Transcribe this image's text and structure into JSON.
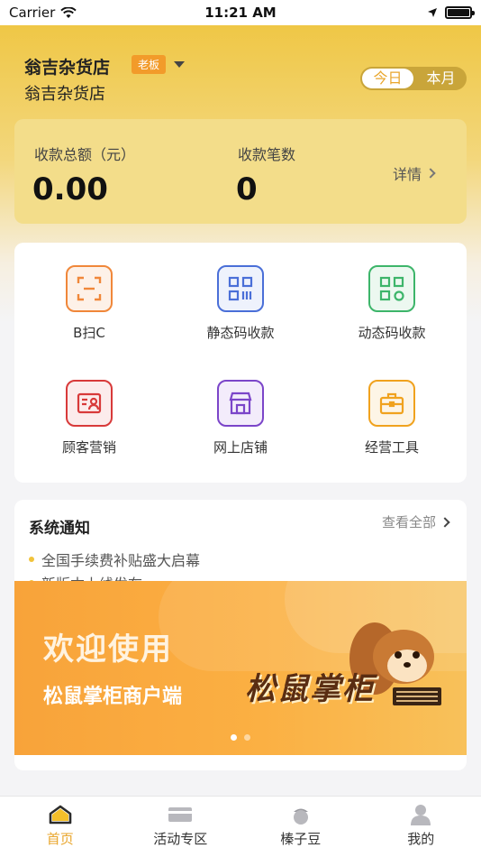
{
  "status_bar": {
    "carrier": "Carrier",
    "time": "11:21 AM"
  },
  "header": {
    "store_name": "翁吉杂货店",
    "role_badge": "老板",
    "store_subtitle": "翁吉杂货店",
    "period_toggle": {
      "today": "今日",
      "month": "本月",
      "selected": "today"
    }
  },
  "summary": {
    "amount_label": "收款总额（元）",
    "amount_value": "0.00",
    "count_label": "收款笔数",
    "count_value": "0",
    "details_label": "详情"
  },
  "features": [
    {
      "label": "B扫C",
      "icon": "scan-frame-icon",
      "color": "#f0873a",
      "bg": "#fdf1e8"
    },
    {
      "label": "静态码收款",
      "icon": "qr-code-icon",
      "color": "#4a6fd8",
      "bg": "#eef2fc"
    },
    {
      "label": "动态码收款",
      "icon": "dynamic-qr-icon",
      "color": "#3db56a",
      "bg": "#ecf8f0"
    },
    {
      "label": "顾客营销",
      "icon": "customer-card-icon",
      "color": "#d83a3a",
      "bg": "#fcecec"
    },
    {
      "label": "网上店铺",
      "icon": "storefront-icon",
      "color": "#7b45c9",
      "bg": "#f3ecfb"
    },
    {
      "label": "经营工具",
      "icon": "toolbox-icon",
      "color": "#f0a21e",
      "bg": "#fdf5e6"
    }
  ],
  "notices": {
    "title": "系统通知",
    "view_all": "查看全部",
    "items": [
      "全国手续费补贴盛大启幕",
      "新版本上线发布"
    ]
  },
  "banner": {
    "title": "欢迎使用",
    "subtitle": "松鼠掌柜商户端",
    "logo_text": "松鼠掌柜"
  },
  "tabbar": {
    "items": [
      {
        "label": "首页",
        "icon": "home-icon",
        "active": true
      },
      {
        "label": "活动专区",
        "icon": "card-icon",
        "active": false
      },
      {
        "label": "榛子豆",
        "icon": "hazelnut-icon",
        "active": false
      },
      {
        "label": "我的",
        "icon": "profile-icon",
        "active": false
      }
    ]
  }
}
